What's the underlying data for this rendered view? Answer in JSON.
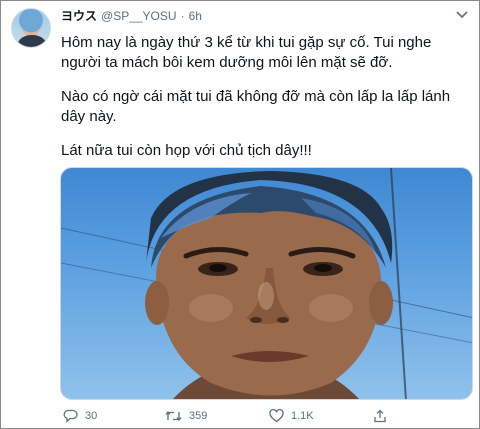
{
  "tweet": {
    "display_name": "ヨウス",
    "handle": "@SP__YOSU",
    "separator": "·",
    "time": "6h",
    "paragraphs": [
      "Hôm nay là ngày thứ 3 kể từ khi tui gặp sự cố. Tui nghe người ta mách bôi kem dưỡng môi lên mặt sẽ đỡ.",
      "Nào có ngờ cái mặt tui đã không đỡ mà còn lấp la lấp lánh dây này.",
      "Lát nữa tui còn họp với chủ tịch dây!!!"
    ]
  },
  "actions": {
    "reply_count": "30",
    "retweet_count": "359",
    "like_count": "1.1K"
  },
  "icons": {
    "caret": "chevron-down-icon",
    "reply": "comment-icon",
    "retweet": "retweet-icon",
    "like": "heart-icon",
    "share": "share-icon"
  },
  "colors": {
    "text": "#0f1419",
    "secondary": "#5b7083",
    "sky": "#5b9fe0"
  }
}
